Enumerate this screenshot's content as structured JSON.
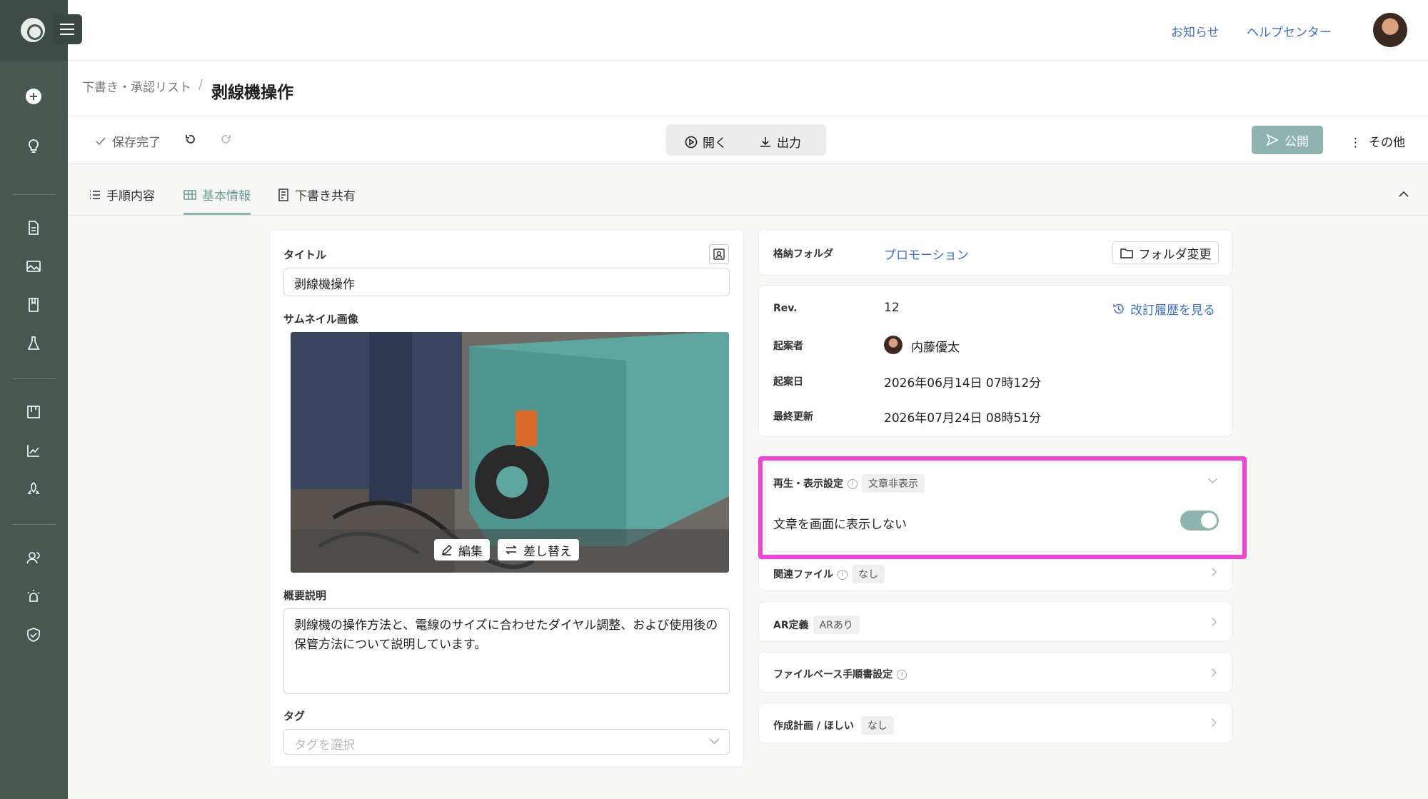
{
  "header": {
    "news": "お知らせ",
    "help": "ヘルプセンター"
  },
  "breadcrumb": {
    "parent": "下書き・承認リスト",
    "separator": "/",
    "title": "剥線機操作"
  },
  "toolbar": {
    "saved": "保存完了",
    "open": "開く",
    "export": "出力",
    "publish": "公開",
    "other": "その他"
  },
  "tabs": {
    "steps": "手順内容",
    "basic": "基本情報",
    "share": "下書き共有"
  },
  "form": {
    "title_label": "タイトル",
    "title_value": "剥線機操作",
    "thumb_label": "サムネイル画像",
    "edit": "編集",
    "replace": "差し替え",
    "desc_label": "概要説明",
    "desc_value": "剥線機の操作方法と、電線のサイズに合わせたダイヤル調整、および使用後の保管方法について説明しています。",
    "tag_label": "タグ",
    "tag_placeholder": "タグを選択"
  },
  "folder": {
    "label": "格納フォルダ",
    "value": "プロモーション",
    "change": "フォルダ変更"
  },
  "meta": {
    "rev_label": "Rev.",
    "rev_value": "12",
    "history": "改訂履歴を見る",
    "author_label": "起案者",
    "author_value": "内藤優太",
    "created_label": "起案日",
    "created_value": "2026年06月14日 07時12分",
    "updated_label": "最終更新",
    "updated_value": "2026年07月24日 08時51分"
  },
  "playback": {
    "label": "再生・表示設定",
    "chip": "文章非表示",
    "option": "文章を画面に表示しない",
    "toggle_on": true
  },
  "related": {
    "label": "関連ファイル",
    "chip": "なし"
  },
  "ar": {
    "label": "AR定義",
    "chip": "ARあり"
  },
  "filebase": {
    "label": "ファイルベース手順書設定"
  },
  "plan": {
    "label": "作成計画 / ほしい",
    "chip": "なし"
  },
  "colors": {
    "sidebar": "#4a5751",
    "accent": "#8fb3ae",
    "highlight": "#f044d6",
    "link": "#3d6fd0"
  }
}
